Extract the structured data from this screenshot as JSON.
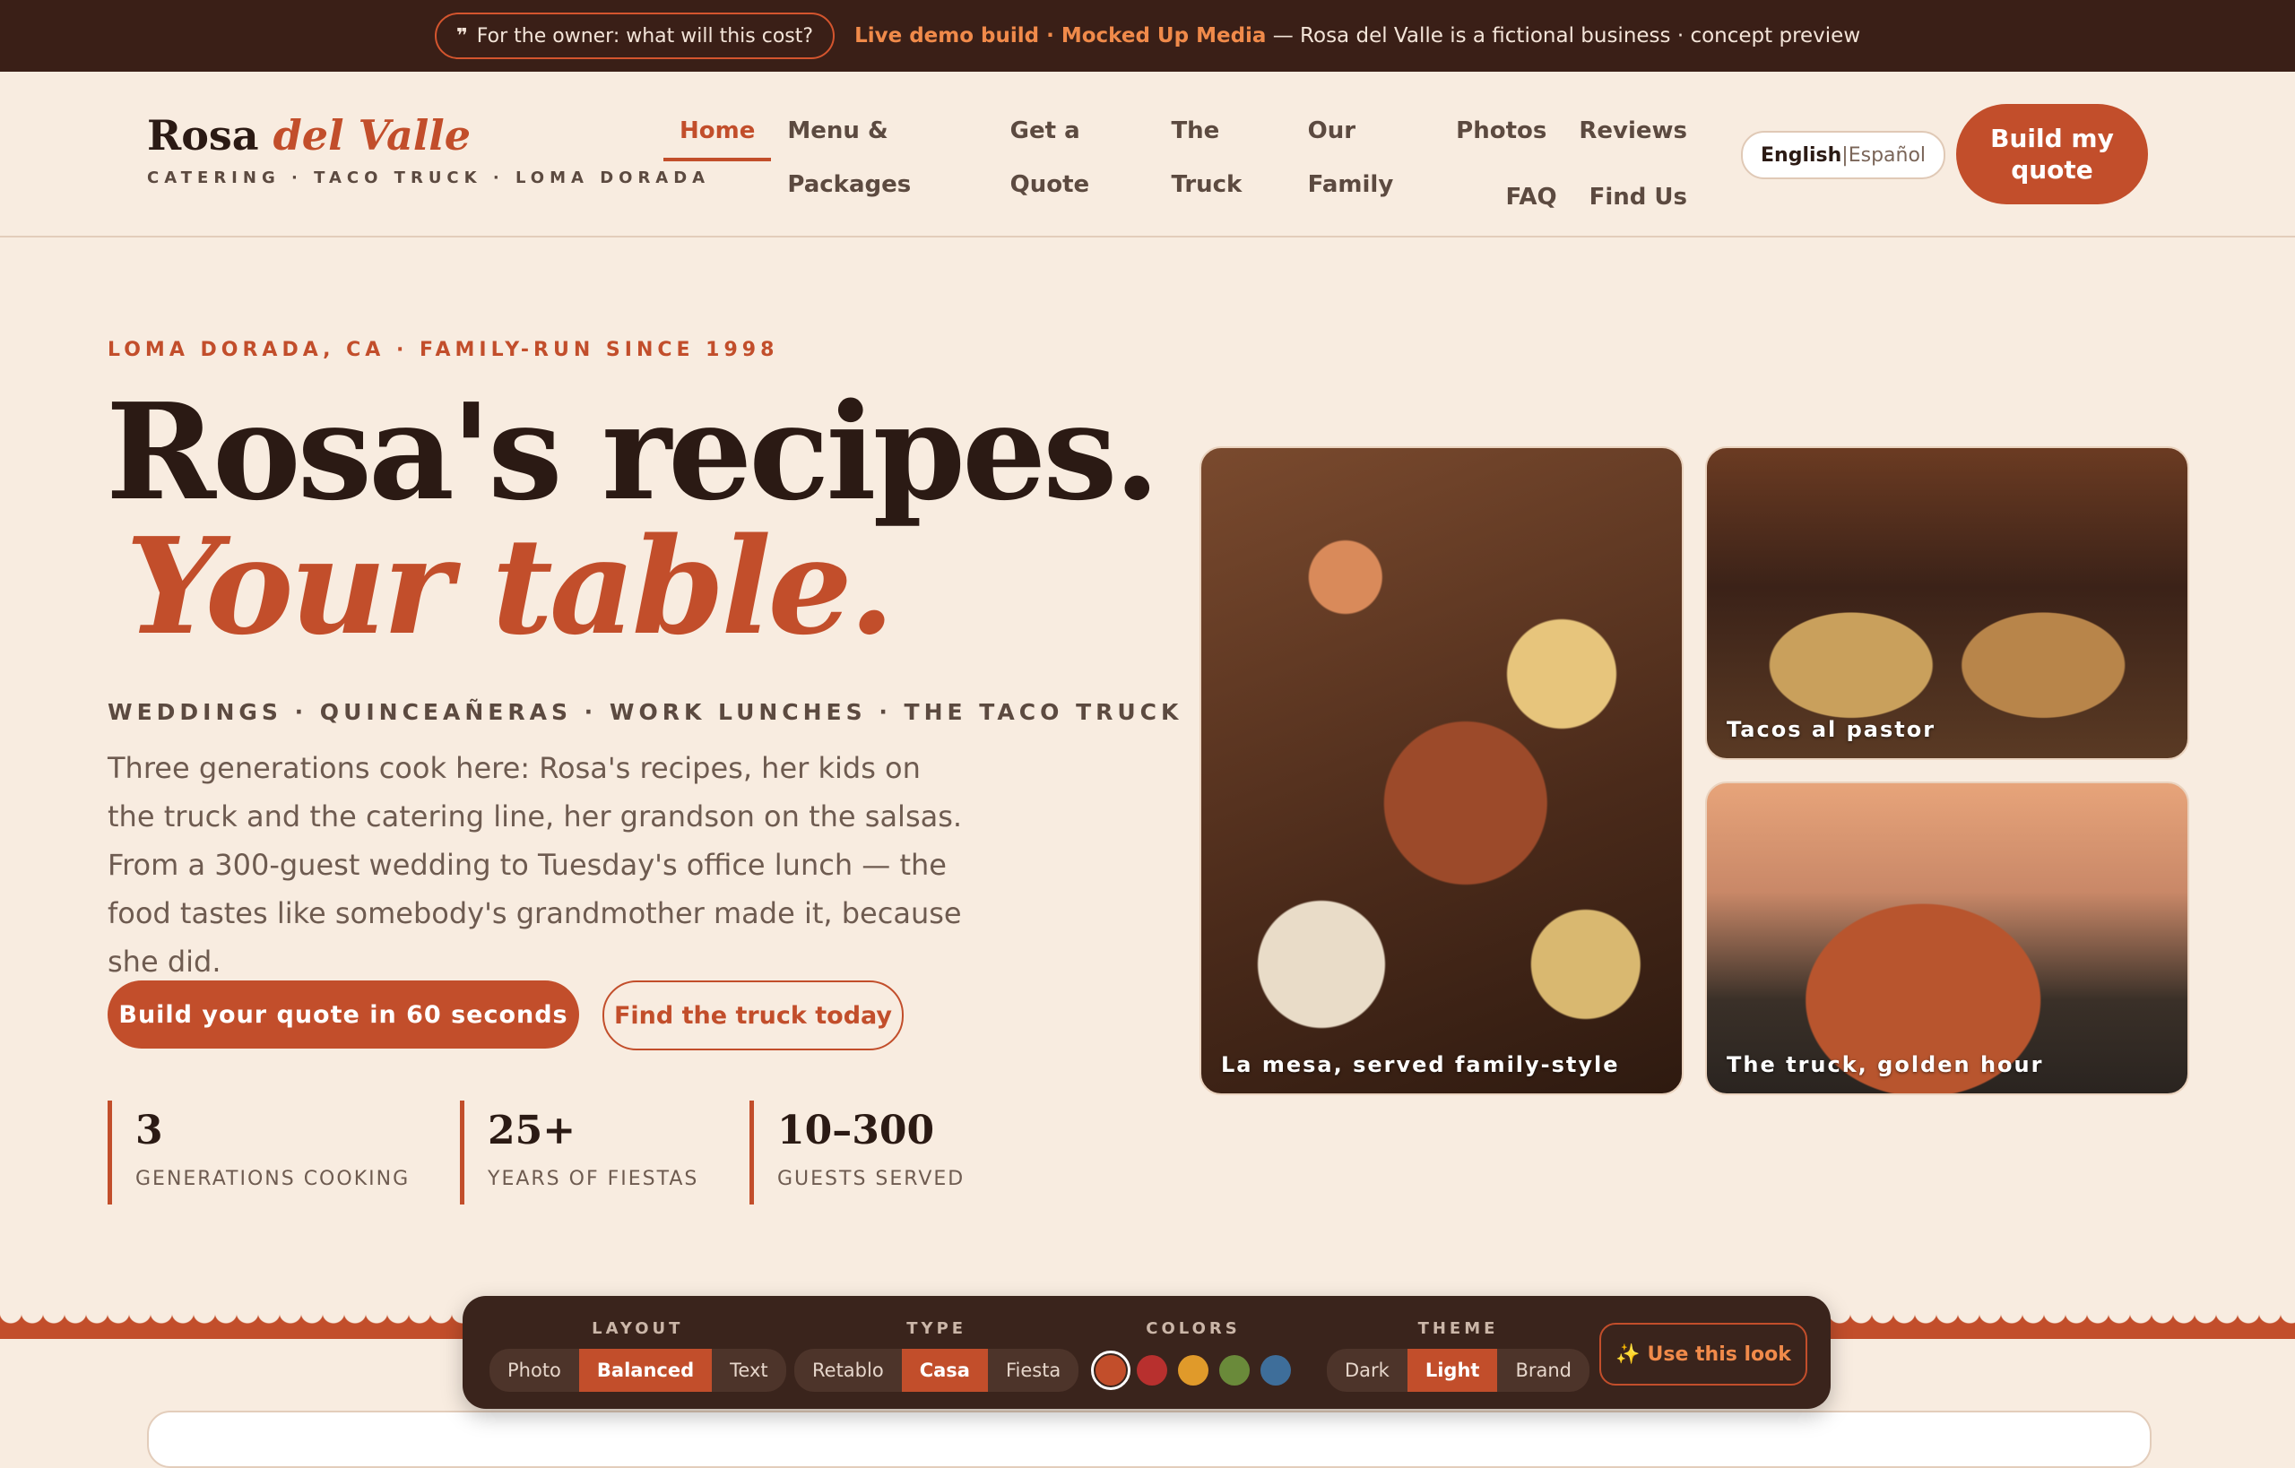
{
  "topbar": {
    "owner_pill_icon": "❞",
    "owner_pill": "For the owner: what will this cost?",
    "demo_highlight": "Live demo build · Mocked Up Media",
    "demo_rest": " — Rosa del Valle is a fictional business · concept preview"
  },
  "header": {
    "brand_main": "Rosa ",
    "brand_italic": "del Valle",
    "brand_sub": "CATERING · TACO TRUCK · LOMA DORADA",
    "nav": [
      "Home",
      "Menu & Packages",
      "Get a Quote",
      "The Truck",
      "Our Family",
      "Photos",
      "Reviews"
    ],
    "nav2": [
      "FAQ",
      "Find Us"
    ],
    "lang_on": "English",
    "lang_sep": " | ",
    "lang_off": "Español",
    "quote_button": "Build my quote"
  },
  "hero": {
    "eyebrow": "LOMA DORADA, CA · FAMILY-RUN SINCE 1998",
    "title_line1": "Rosa's recipes.",
    "title_line2": "Your table.",
    "services": "WEDDINGS · QUINCEAÑERAS · WORK LUNCHES · THE TACO TRUCK",
    "lede": "Three generations cook here: Rosa's recipes, her kids on the truck and the catering line, her grandson on the salsas. From a 300-guest wedding to Tuesday's office lunch — the food tastes like somebody's grandmother made it, because she did.",
    "cta_primary": "Build your quote in 60 seconds",
    "cta_secondary": "Find the truck today",
    "stats": [
      {
        "num": "3",
        "label": "GENERATIONS COOKING"
      },
      {
        "num": "25+",
        "label": "YEARS OF FIESTAS"
      },
      {
        "num": "10–300",
        "label": "GUESTS SERVED"
      }
    ]
  },
  "photos": [
    {
      "caption": "La mesa, served family-style"
    },
    {
      "caption": "Tacos al pastor"
    },
    {
      "caption": "The truck, golden hour"
    }
  ],
  "toolbar": {
    "layout_label": "LAYOUT",
    "layout_options": [
      "Photo",
      "Balanced",
      "Text"
    ],
    "type_label": "TYPE",
    "type_options": [
      "Retablo",
      "Casa",
      "Fiesta"
    ],
    "colors_label": "COLORS",
    "colors": [
      "#c24e2b",
      "#b8302e",
      "#e09a2a",
      "#6a8a3a",
      "#3e6e9a"
    ],
    "theme_label": "THEME",
    "theme_options": [
      "Dark",
      "Light",
      "Brand"
    ],
    "use_icon": "✨",
    "use_button": "Use this look"
  }
}
